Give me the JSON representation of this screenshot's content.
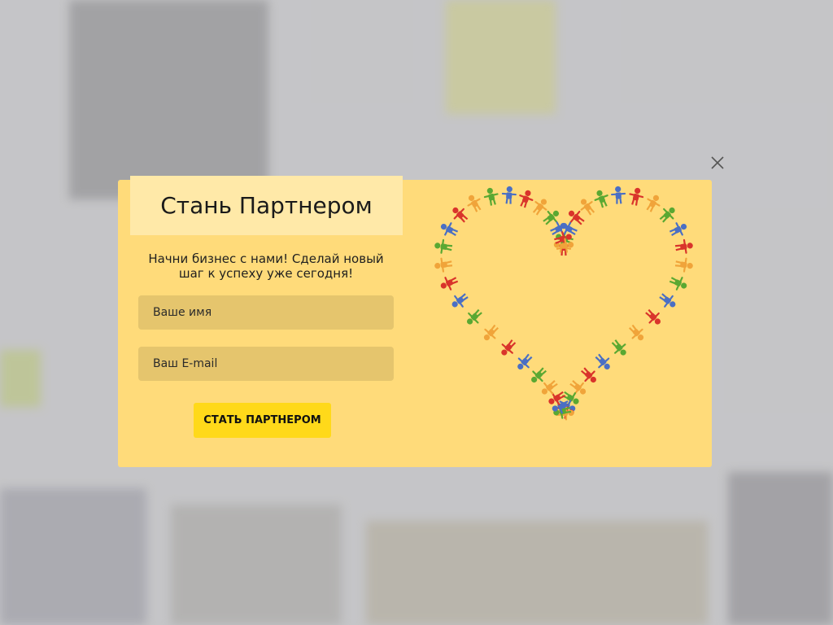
{
  "popup": {
    "title": "Стань Партнером",
    "subtitle": "Начни бизнес с нами! Сделай новый шаг к успеху уже сегодня!",
    "name_placeholder": "Ваше имя",
    "email_placeholder": "Ваш E-mail",
    "submit_label": "СТАТЬ ПАРТНЕРОМ",
    "close_icon": "close-icon",
    "illustration_icon": "heart-of-people-icon"
  },
  "colors": {
    "modal_bg": "#ffdb7a",
    "title_bg": "#ffe9a8",
    "field_bg": "#e5c56d",
    "button_bg": "#ffd91a",
    "people": [
      "#d9342b",
      "#f0a43a",
      "#5aa832",
      "#4a6fc4"
    ]
  }
}
